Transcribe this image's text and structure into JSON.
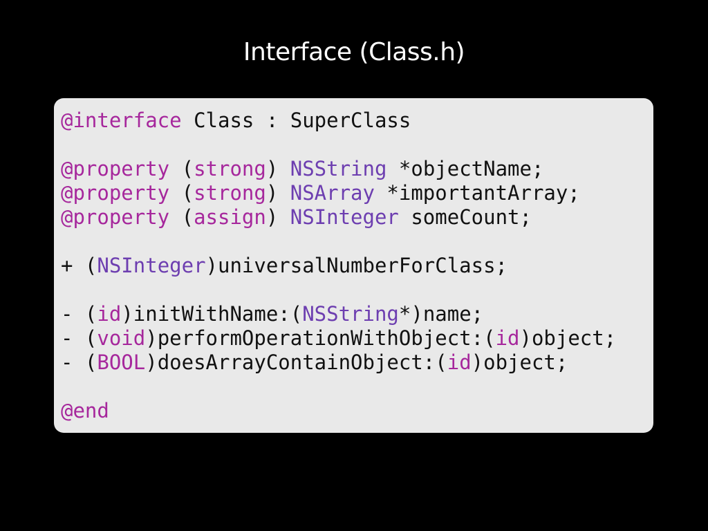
{
  "title": "Interface (Class.h)",
  "colors": {
    "background": "#000000",
    "panel": "#e9e9e9",
    "keyword": "#a6279c",
    "type": "#6d3eb0",
    "text": "#111111"
  },
  "code": {
    "lines": [
      [
        {
          "t": "@interface",
          "c": "kw"
        },
        {
          "t": " Class : SuperClass",
          "c": "plain"
        }
      ],
      [],
      [
        {
          "t": "@property",
          "c": "kw"
        },
        {
          "t": " (",
          "c": "plain"
        },
        {
          "t": "strong",
          "c": "kw"
        },
        {
          "t": ") ",
          "c": "plain"
        },
        {
          "t": "NSString",
          "c": "type"
        },
        {
          "t": " *objectName;",
          "c": "plain"
        }
      ],
      [
        {
          "t": "@property",
          "c": "kw"
        },
        {
          "t": " (",
          "c": "plain"
        },
        {
          "t": "strong",
          "c": "kw"
        },
        {
          "t": ") ",
          "c": "plain"
        },
        {
          "t": "NSArray",
          "c": "type"
        },
        {
          "t": " *importantArray;",
          "c": "plain"
        }
      ],
      [
        {
          "t": "@property",
          "c": "kw"
        },
        {
          "t": " (",
          "c": "plain"
        },
        {
          "t": "assign",
          "c": "kw"
        },
        {
          "t": ") ",
          "c": "plain"
        },
        {
          "t": "NSInteger",
          "c": "type"
        },
        {
          "t": " someCount;",
          "c": "plain"
        }
      ],
      [],
      [
        {
          "t": "+ (",
          "c": "plain"
        },
        {
          "t": "NSInteger",
          "c": "type"
        },
        {
          "t": ")universalNumberForClass;",
          "c": "plain"
        }
      ],
      [],
      [
        {
          "t": "- (",
          "c": "plain"
        },
        {
          "t": "id",
          "c": "kw"
        },
        {
          "t": ")initWithName:(",
          "c": "plain"
        },
        {
          "t": "NSString",
          "c": "type"
        },
        {
          "t": "*)name;",
          "c": "plain"
        }
      ],
      [
        {
          "t": "- (",
          "c": "plain"
        },
        {
          "t": "void",
          "c": "kw"
        },
        {
          "t": ")performOperationWithObject:(",
          "c": "plain"
        },
        {
          "t": "id",
          "c": "kw"
        },
        {
          "t": ")object;",
          "c": "plain"
        }
      ],
      [
        {
          "t": "- (",
          "c": "plain"
        },
        {
          "t": "BOOL",
          "c": "kw"
        },
        {
          "t": ")doesArrayContainObject:(",
          "c": "plain"
        },
        {
          "t": "id",
          "c": "kw"
        },
        {
          "t": ")object;",
          "c": "plain"
        }
      ],
      [],
      [
        {
          "t": "@end",
          "c": "kw"
        }
      ]
    ]
  }
}
